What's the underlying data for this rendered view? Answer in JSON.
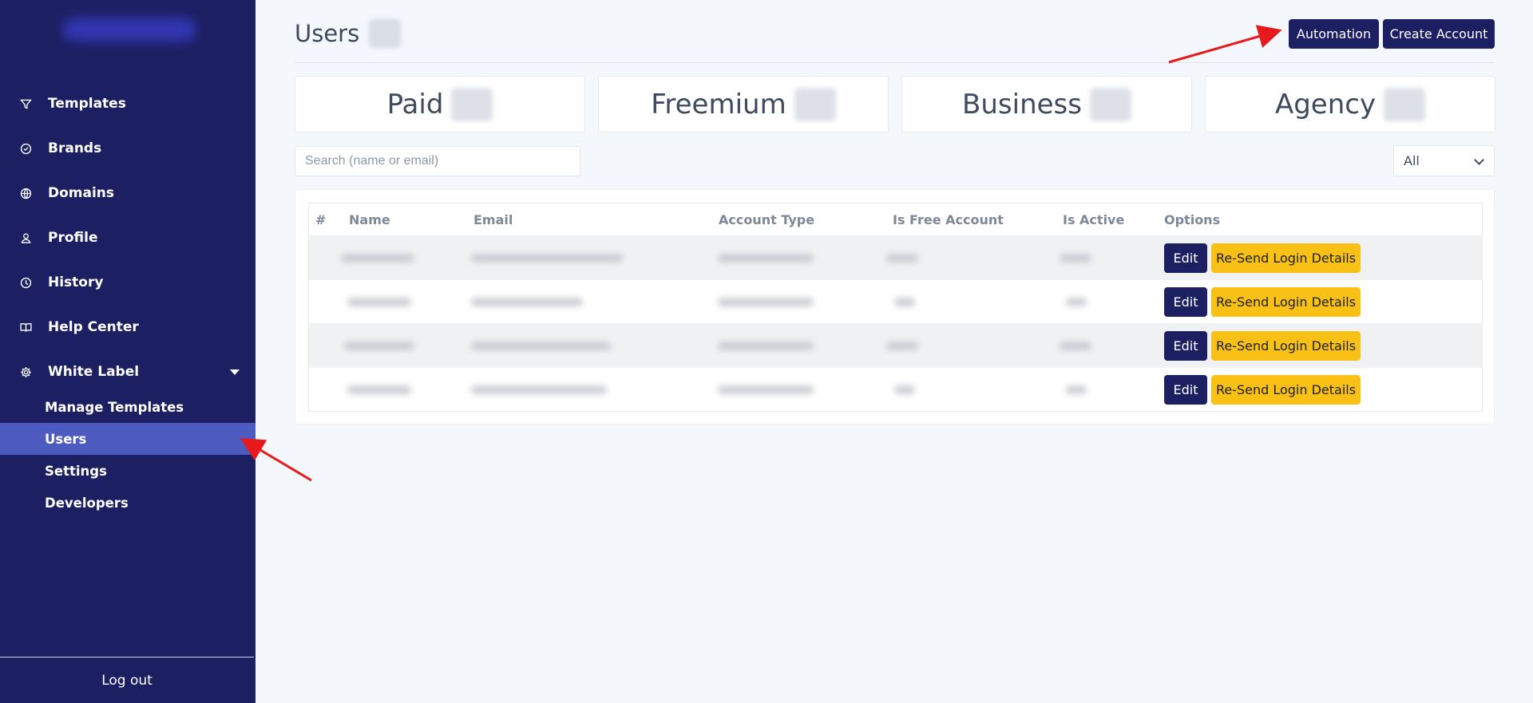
{
  "sidebar": {
    "items": [
      {
        "label": "Templates",
        "icon": "filter-icon"
      },
      {
        "label": "Brands",
        "icon": "badge-check-icon"
      },
      {
        "label": "Domains",
        "icon": "globe-icon"
      },
      {
        "label": "Profile",
        "icon": "user-icon"
      },
      {
        "label": "History",
        "icon": "clock-icon"
      },
      {
        "label": "Help Center",
        "icon": "book-icon"
      },
      {
        "label": "White Label",
        "icon": "gear-icon"
      }
    ],
    "sub_items": [
      "Manage Templates",
      "Users",
      "Settings",
      "Developers"
    ],
    "active_sub": "Users",
    "logout": "Log out"
  },
  "header": {
    "title": "Users",
    "automation": "Automation",
    "create_account": "Create Account"
  },
  "stats": [
    "Paid",
    "Freemium",
    "Business",
    "Agency"
  ],
  "search": {
    "placeholder": "Search (name or email)"
  },
  "filter": {
    "value": "All"
  },
  "table": {
    "columns": [
      "#",
      "Name",
      "Email",
      "Account Type",
      "Is Free Account",
      "Is Active",
      "Options"
    ],
    "edit_label": "Edit",
    "resend_label": "Re-Send Login Details"
  },
  "colors": {
    "sidebar_bg": "#1c1f62",
    "active_item": "#4d5bc0",
    "primary_button": "#1c1f62",
    "warning_button": "#f9c016",
    "annotation_arrow": "#e8191d"
  }
}
